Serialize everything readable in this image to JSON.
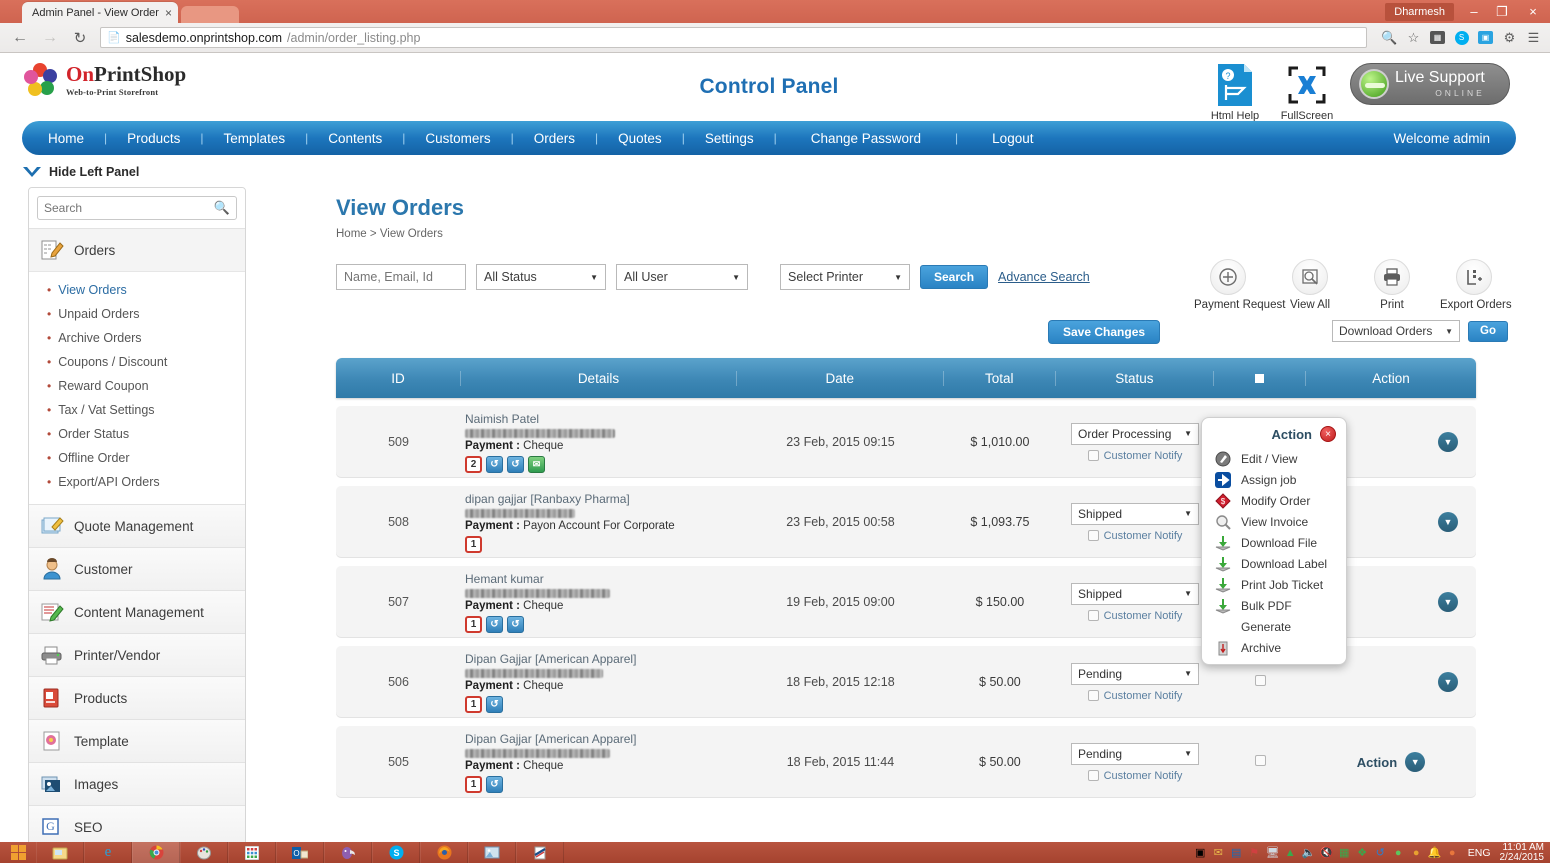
{
  "browser": {
    "tab_title": "Admin Panel - View Order",
    "tab_close": "×",
    "window_user": "Dharmesh",
    "minimize": "–",
    "maximize": "❐",
    "close": "×",
    "back_icon": "←",
    "forward_icon": "→",
    "reload_icon": "↻",
    "url_domain": "salesdemo.onprintshop.com",
    "url_path": "/admin/order_listing.php",
    "toolbar_icons": [
      "zoom-out-icon",
      "bookmark-star-icon",
      "extension-icon",
      "skype-icon",
      "screenshot-icon",
      "settings-gear-icon",
      "chrome-menu-icon"
    ]
  },
  "header": {
    "brand_on": "On",
    "brand_rest": "PrintShop",
    "brand_sub": "Web-to-Print Storefront",
    "control_panel": "Control Panel",
    "html_help": "Html Help",
    "full_screen": "FullScreen",
    "live_support": "Live Support",
    "live_support_status": "ONLINE"
  },
  "menu": {
    "items": [
      "Home",
      "Products",
      "Templates",
      "Contents",
      "Customers",
      "Orders",
      "Quotes",
      "Settings",
      "Change Password",
      "Logout"
    ],
    "separator": "|",
    "welcome": "Welcome admin",
    "hide_left_panel": "Hide Left Panel"
  },
  "sidebar": {
    "search_placeholder": "Search",
    "groups": [
      {
        "label": "Orders",
        "icon": "orders-icon",
        "active": true,
        "links": [
          "View Orders",
          "Unpaid Orders",
          "Archive Orders",
          "Coupons / Discount",
          "Reward Coupon",
          "Tax / Vat Settings",
          "Order Status",
          "Offline Order",
          "Export/API Orders"
        ],
        "selected": "View Orders"
      },
      {
        "label": "Quote Management",
        "icon": "quote-icon"
      },
      {
        "label": "Customer",
        "icon": "customer-icon"
      },
      {
        "label": "Content Management",
        "icon": "content-icon"
      },
      {
        "label": "Printer/Vendor",
        "icon": "printer-icon"
      },
      {
        "label": "Products",
        "icon": "products-icon"
      },
      {
        "label": "Template",
        "icon": "template-icon"
      },
      {
        "label": "Images",
        "icon": "images-icon"
      },
      {
        "label": "SEO",
        "icon": "seo-icon"
      }
    ]
  },
  "main": {
    "page_title": "View Orders",
    "breadcrumb_home": "Home",
    "breadcrumb_sep": ">",
    "breadcrumb_current": "View Orders",
    "filters": {
      "keyword_placeholder": "Name, Email, Id",
      "status_value": "All Status",
      "user_value": "All User",
      "printer_value": "Select Printer",
      "search_button": "Search",
      "advance_search": "Advance Search"
    },
    "tools": [
      {
        "label": "Payment Request",
        "icon": "plus-circle-icon"
      },
      {
        "label": "View All",
        "icon": "view-all-icon"
      },
      {
        "label": "Print",
        "icon": "printer-icon"
      },
      {
        "label": "Export Orders",
        "icon": "export-icon"
      }
    ],
    "save_changes": "Save Changes",
    "download_orders": "Download Orders",
    "go_button": "Go"
  },
  "table": {
    "columns": [
      "ID",
      "Details",
      "Date",
      "Total",
      "Status",
      "",
      "Action"
    ],
    "select_all_icon": "select-all-checkbox",
    "action_label": "Action",
    "notify_label": "Customer Notify",
    "rows": [
      {
        "id": "509",
        "customer": "Naimish Patel",
        "email_redacted": true,
        "payment_label": "Payment :",
        "payment_method": "Cheque",
        "badges": [
          "2",
          "blue",
          "blue",
          "green"
        ],
        "date": "23 Feb, 2015 09:15",
        "total": "$ 1,010.00",
        "status": "Order Processing"
      },
      {
        "id": "508",
        "customer": "dipan gajjar [Ranbaxy Pharma]",
        "email_redacted": true,
        "payment_label": "Payment :",
        "payment_method": "Payon Account For Corporate",
        "badges": [
          "1"
        ],
        "date": "23 Feb, 2015 00:58",
        "total": "$ 1,093.75",
        "status": "Shipped"
      },
      {
        "id": "507",
        "customer": "Hemant kumar",
        "email_redacted": true,
        "payment_label": "Payment :",
        "payment_method": "Cheque",
        "badges": [
          "1",
          "blue",
          "blue"
        ],
        "date": "19 Feb, 2015 09:00",
        "total": "$ 150.00",
        "status": "Shipped"
      },
      {
        "id": "506",
        "customer": "Dipan Gajjar [American Apparel]",
        "email_redacted": true,
        "payment_label": "Payment :",
        "payment_method": "Cheque",
        "badges": [
          "1",
          "blue"
        ],
        "date": "18 Feb, 2015 12:18",
        "total": "$ 50.00",
        "status": "Pending"
      },
      {
        "id": "505",
        "customer": "Dipan Gajjar [American Apparel]",
        "email_redacted": true,
        "payment_label": "Payment :",
        "payment_method": "Cheque",
        "badges": [
          "1",
          "blue"
        ],
        "date": "18 Feb, 2015 11:44",
        "total": "$ 50.00",
        "status": "Pending"
      }
    ]
  },
  "action_menu": {
    "title": "Action",
    "close_icon": "×",
    "items": [
      {
        "label": "Edit / View",
        "icon": "pencil-circle-icon"
      },
      {
        "label": "Assign job",
        "icon": "arrow-right-icon"
      },
      {
        "label": "Modify Order",
        "icon": "dollar-diamond-icon"
      },
      {
        "label": "View Invoice",
        "icon": "magnifier-icon"
      },
      {
        "label": "Download File",
        "icon": "download-icon"
      },
      {
        "label": "Download Label",
        "icon": "download-icon"
      },
      {
        "label": "Print Job Ticket",
        "icon": "download-icon"
      },
      {
        "label": "Bulk PDF",
        "icon": "download-icon"
      },
      {
        "label": "Generate",
        "icon": "none-icon"
      },
      {
        "label": "Archive",
        "icon": "archive-bin-icon"
      }
    ]
  },
  "taskbar": {
    "start_icon": "windows-start-icon",
    "apps": [
      "explorer-icon",
      "internet-explorer-icon",
      "chrome-icon",
      "paint-icon",
      "calculator-icon",
      "outlook-icon",
      "thunderbird-icon",
      "skype-icon",
      "firefox-icon",
      "photo-viewer-icon",
      "editor-icon"
    ],
    "tray_icons": [
      "notify-icon",
      "mail-icon",
      "outlook-tray-icon",
      "pdf-icon",
      "network-icon",
      "drive-icon",
      "volume-icon",
      "mute-icon",
      "excel-icon",
      "dropbox-icon",
      "sync-icon",
      "green-icon",
      "orange-icon",
      "bell-icon",
      "chrome-tray-icon"
    ],
    "language": "ENG",
    "time": "11:01 AM",
    "date": "2/24/2015"
  }
}
